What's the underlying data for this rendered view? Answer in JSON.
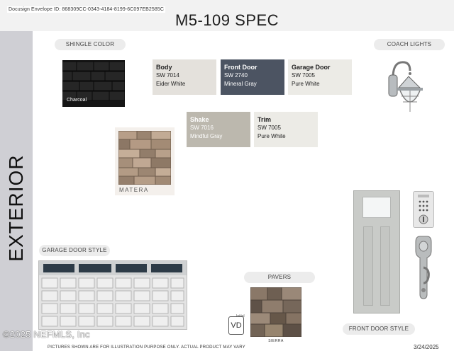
{
  "header": {
    "envelope_id": "Docusign Envelope ID: 868309CC-0343-4184-8199-6C097EB2585C",
    "title": "M5-109 SPEC"
  },
  "sidebar": {
    "label": "EXTERIOR"
  },
  "sections": {
    "shingle": "SHINGLE COLOR",
    "coach_lights": "COACH LIGHTS",
    "garage_door": "GARAGE DOOR STYLE",
    "pavers": "PAVERS",
    "front_door": "FRONT DOOR STYLE"
  },
  "shingle": {
    "label": "Charcoal",
    "color": "#151515"
  },
  "paint": [
    {
      "name": "Body",
      "code": "SW 7014",
      "color_name": "Eider White",
      "hex": "#e4e1dc",
      "text": "#222222"
    },
    {
      "name": "Front Door",
      "code": "SW 2740",
      "color_name": "Mineral Gray",
      "hex": "#4c5462",
      "text": "#ffffff"
    },
    {
      "name": "Garage Door",
      "code": "SW 7005",
      "color_name": "Pure White",
      "hex": "#ecebe6",
      "text": "#222222"
    },
    {
      "name": "Shake",
      "code": "SW 7016",
      "color_name": "Mindful Gray",
      "hex": "#bcb8ae",
      "text": "#ffffff"
    },
    {
      "name": "Trim",
      "code": "SW 7005",
      "color_name": "Pure White",
      "hex": "#ecebe6",
      "text": "#222222"
    }
  ],
  "stone": {
    "label": "MATERA"
  },
  "pavers": {
    "label": "SIERRA"
  },
  "badge": {
    "caption": "Initial",
    "letters": "VD"
  },
  "footer": {
    "watermark": "©2025 NEFMLS, Inc",
    "disclaimer": "PICTURES SHOWN ARE FOR ILLUSTRATION PURPOSE ONLY. ACTUAL PRODUCT MAY VARY",
    "date": "3/24/2025"
  }
}
